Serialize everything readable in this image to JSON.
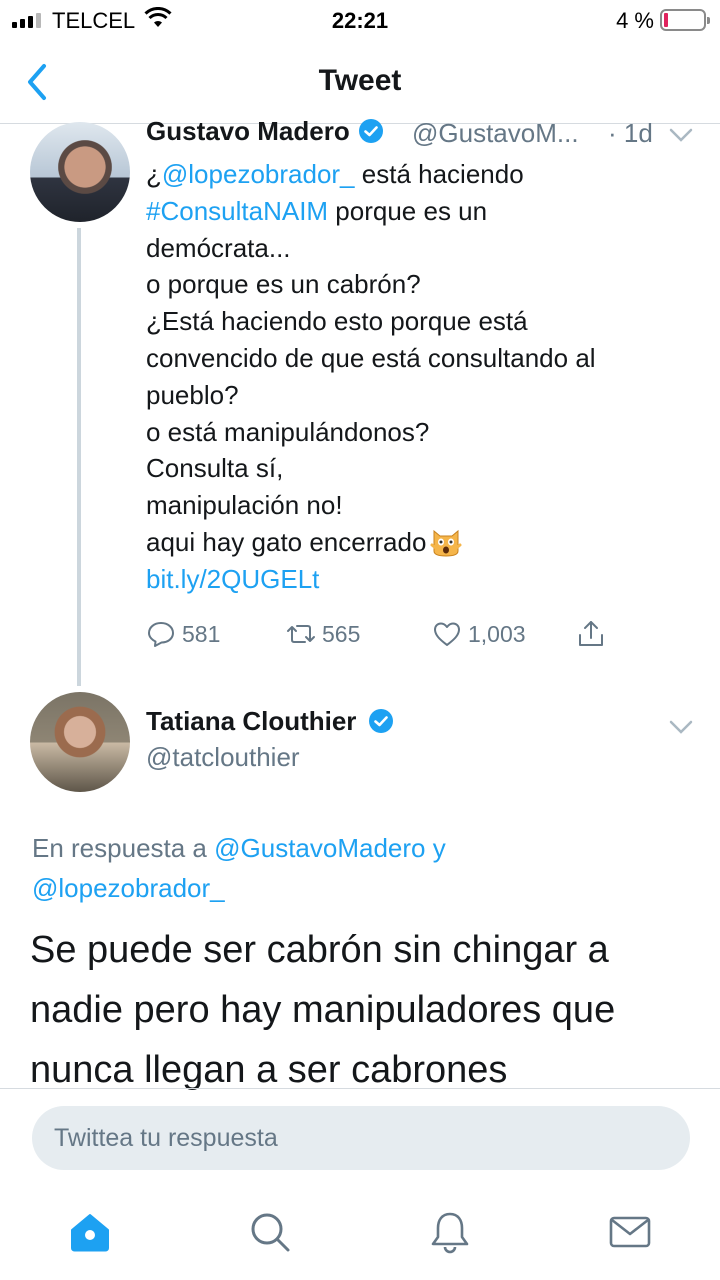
{
  "status_bar": {
    "carrier": "TELCEL",
    "time": "22:21",
    "battery_pct": "4 %",
    "battery_level": 0.04,
    "battery_color": "#e0245e"
  },
  "header": {
    "title": "Tweet",
    "back_icon": "chevron-left-icon"
  },
  "tweet1": {
    "author_name": "Gustavo Madero",
    "handle": "@GustavoM...",
    "time": "· 1d",
    "lines": [
      {
        "pre": "¿",
        "link": "@lopezobrador_",
        "post": " está haciendo"
      },
      {
        "pre": "",
        "link": "#ConsultaNAIM",
        "post": " porque es un"
      },
      {
        "pre": "demócrata...",
        "link": "",
        "post": ""
      },
      {
        "pre": "o porque es un cabrón?",
        "link": "",
        "post": ""
      },
      {
        "pre": "¿Está haciendo esto porque está",
        "link": "",
        "post": ""
      },
      {
        "pre": "convencido de que está consultando al",
        "link": "",
        "post": ""
      },
      {
        "pre": "pueblo?",
        "link": "",
        "post": ""
      },
      {
        "pre": "o está manipulándonos?",
        "link": "",
        "post": ""
      },
      {
        "pre": "Consulta sí,",
        "link": "",
        "post": ""
      },
      {
        "pre": "manipulación no!",
        "link": "",
        "post": ""
      },
      {
        "pre": "aqui hay gato encerrado",
        "link": "",
        "post": ""
      },
      {
        "pre": "",
        "link": "bit.ly/2QUGELt",
        "post": ""
      }
    ],
    "emoji": "weary-cat-icon",
    "actions": {
      "replies": "581",
      "retweets": "565",
      "likes": "1,003"
    }
  },
  "tweet2": {
    "author_name": "Tatiana Clouthier",
    "handle": "@tatclouthier",
    "reply_prefix": "En respuesta a ",
    "reply_user1": "@GustavoMadero",
    "reply_and": " y",
    "reply_user2": "@lopezobrador_",
    "text_lines": [
      "Se puede ser cabrón sin chingar a",
      "nadie pero hay manipuladores que",
      "nunca llegan a ser cabrones"
    ]
  },
  "reply_bar": {
    "placeholder": "Twittea tu respuesta"
  },
  "tabs": [
    "home-icon",
    "search-icon",
    "notifications-icon",
    "messages-icon"
  ],
  "colors": {
    "accent": "#1da1f2",
    "secondary_text": "#657786",
    "primary_text": "#14171a"
  }
}
